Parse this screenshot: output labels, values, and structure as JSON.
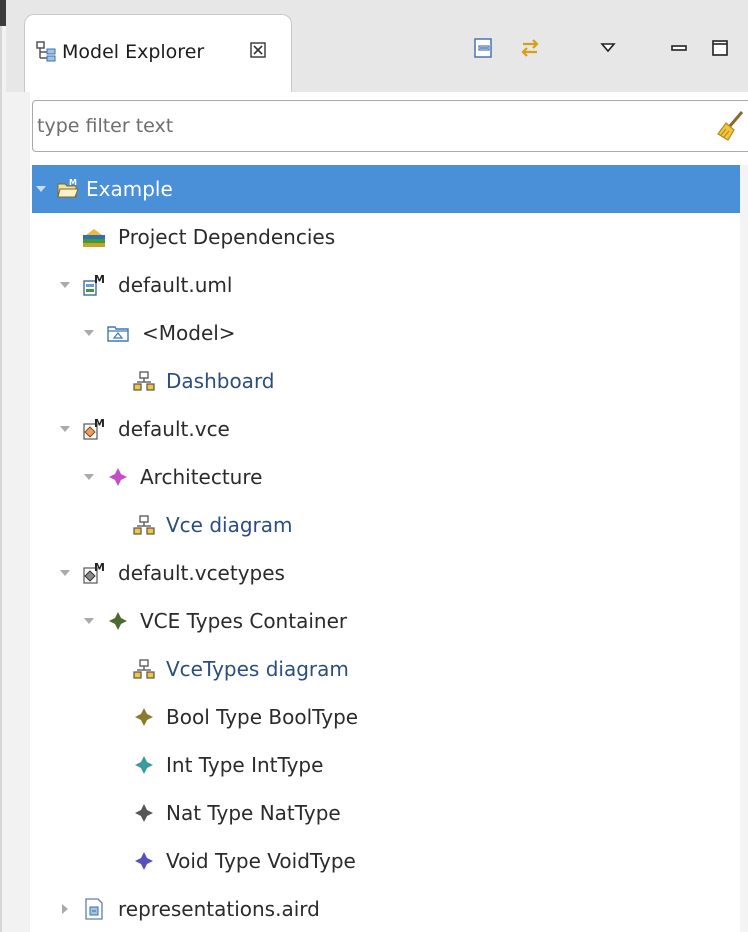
{
  "view": {
    "tab_title": "Model Explorer",
    "close_glyph": "☒"
  },
  "filter": {
    "placeholder": "type filter text",
    "value": ""
  },
  "toolbar": {
    "collapse_all_icon": "collapse-all-icon",
    "link_with_editor_icon": "link-with-editor-icon",
    "view_menu_icon": "view-menu-icon",
    "minimize_icon": "minimize-icon",
    "maximize_icon": "maximize-icon"
  },
  "colors": {
    "selection": "#4a90d9",
    "diagram_text": "#2a4f7f",
    "architecture_icon": "#c04fc8",
    "vce_types_icon": "#4b6b2f",
    "bool_type_icon": "#8a7b2c",
    "int_type_icon": "#3b9a9a",
    "nat_type_icon": "#555555",
    "void_type_icon": "#5a4fc0"
  },
  "tree": {
    "nodes": [
      {
        "label": "Example",
        "icon": "project-folder-icon",
        "expanded": true,
        "selected": true
      },
      {
        "label": "Project Dependencies",
        "icon": "library-icon"
      },
      {
        "label": "default.uml",
        "icon": "uml-model-file-icon",
        "expanded": true
      },
      {
        "label": "<Model>",
        "icon": "package-icon",
        "expanded": true
      },
      {
        "label": "Dashboard",
        "icon": "diagram-icon",
        "is_diagram": true
      },
      {
        "label": "default.vce",
        "icon": "vce-model-file-icon",
        "expanded": true
      },
      {
        "label": "Architecture",
        "icon": "architecture-element-icon",
        "expanded": true
      },
      {
        "label": "Vce diagram",
        "icon": "diagram-icon",
        "is_diagram": true
      },
      {
        "label": "default.vcetypes",
        "icon": "vcetypes-model-file-icon",
        "expanded": true
      },
      {
        "label": "VCE Types Container",
        "icon": "types-container-icon",
        "expanded": true
      },
      {
        "label": "VceTypes diagram",
        "icon": "diagram-icon",
        "is_diagram": true
      },
      {
        "label": "Bool Type BoolType",
        "icon": "bool-type-icon"
      },
      {
        "label": "Int Type IntType",
        "icon": "int-type-icon"
      },
      {
        "label": "Nat Type NatType",
        "icon": "nat-type-icon"
      },
      {
        "label": "Void Type VoidType",
        "icon": "void-type-icon"
      },
      {
        "label": "representations.aird",
        "icon": "aird-file-icon",
        "expanded": false
      }
    ]
  }
}
